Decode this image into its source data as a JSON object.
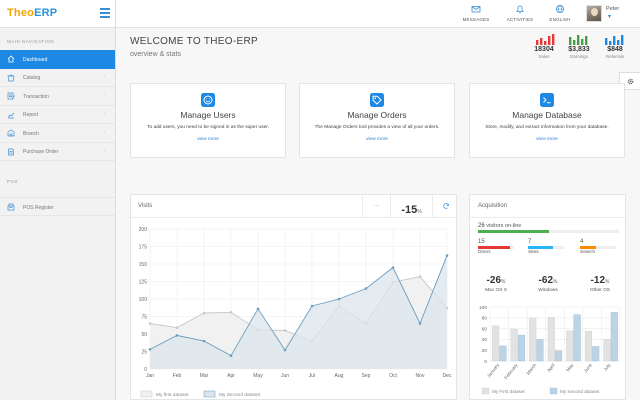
{
  "brand": {
    "part1": "Theo",
    "part2": "ERP"
  },
  "sidebar": {
    "main_heading": "MAIN NAVIGATION",
    "items": [
      {
        "label": "Dashboard",
        "icon": "home-icon",
        "active": true
      },
      {
        "label": "Catalog",
        "icon": "catalog-icon"
      },
      {
        "label": "Transaction",
        "icon": "transaction-icon"
      },
      {
        "label": "Report",
        "icon": "report-icon"
      },
      {
        "label": "Branch",
        "icon": "branch-icon"
      },
      {
        "label": "Purchase Order",
        "icon": "purchase-order-icon"
      }
    ],
    "pos_heading": "POS",
    "pos_items": [
      {
        "label": "POS Register",
        "icon": "pos-register-icon"
      }
    ],
    "chevron": "‹"
  },
  "topbar": {
    "messages": "MESSAGES",
    "activities": "ACTIVITIES",
    "language": "ENGLISH",
    "user_name": "Peter"
  },
  "header": {
    "title": "WELCOME TO THEO-ERP",
    "subtitle": "overview & stats"
  },
  "stats": [
    {
      "value": "18304",
      "label": "Sales",
      "color": "#e53935"
    },
    {
      "value": "$3,833",
      "label": "Earnings",
      "color": "#43a047"
    },
    {
      "value": "$848",
      "label": "Referrals",
      "color": "#1e88e5"
    }
  ],
  "cards": [
    {
      "title": "Manage Users",
      "desc": "To add users, you need to be signed in as the super user.",
      "link": "view more"
    },
    {
      "title": "Manage Orders",
      "desc": "The Manage Orders tool provides a view of all your orders.",
      "link": "view more"
    },
    {
      "title": "Manage Database",
      "desc": "Store, modify, and extract information from your database.",
      "link": "view more"
    }
  ],
  "visits": {
    "title": "Visits",
    "more": "···",
    "value": "-15",
    "unit": "%",
    "legend": [
      "My first dataset",
      "My Second dataset"
    ]
  },
  "acquisition": {
    "title": "Acquisition",
    "online_count": "26",
    "online_label": "visitors on-line",
    "online_fraction": 0.5,
    "sources": [
      {
        "count": "15",
        "label": "Direct",
        "color": "#e53935",
        "fraction": 0.9
      },
      {
        "count": "7",
        "label": "Sites",
        "color": "#29b6f6",
        "fraction": 0.7
      },
      {
        "count": "4",
        "label": "Search",
        "color": "#fb8c00",
        "fraction": 0.45
      }
    ],
    "os": [
      {
        "value": "-26",
        "unit": "%",
        "label": "Mac OS X"
      },
      {
        "value": "-62",
        "unit": "%",
        "label": "Windows"
      },
      {
        "value": "-12",
        "unit": "%",
        "label": "Other OS"
      }
    ],
    "legend": [
      "My First dataset",
      "My Second dataset"
    ]
  },
  "chart_data": [
    {
      "type": "line",
      "x": [
        "Jan",
        "Feb",
        "Mar",
        "Apr",
        "May",
        "Jun",
        "Jul",
        "Aug",
        "Sep",
        "Oct",
        "Nov",
        "Dec"
      ],
      "yticks": [
        0,
        25,
        50,
        75,
        100,
        125,
        150,
        175,
        200
      ],
      "ylim": [
        0,
        200
      ],
      "grid": true,
      "legend_position": "bottom",
      "series": [
        {
          "name": "My first dataset",
          "values": [
            65,
            59,
            80,
            81,
            56,
            55,
            40,
            90,
            65,
            124,
            132,
            87
          ],
          "color": "#c8c8c8",
          "fill": "#f1f1f1"
        },
        {
          "name": "My Second dataset",
          "values": [
            28,
            48,
            40,
            19,
            86,
            27,
            90,
            100,
            115,
            145,
            65,
            162
          ],
          "color": "#6a9fc0",
          "fill": "#dbe4ec"
        }
      ]
    },
    {
      "type": "bar",
      "categories": [
        "January",
        "February",
        "March",
        "April",
        "May",
        "June",
        "July"
      ],
      "yticks": [
        0,
        20,
        40,
        60,
        80,
        100
      ],
      "ylim": [
        0,
        100
      ],
      "grid": true,
      "legend_position": "bottom",
      "series": [
        {
          "name": "My First dataset",
          "values": [
            65,
            59,
            80,
            81,
            56,
            55,
            40
          ],
          "color": "#e2e2e2"
        },
        {
          "name": "My Second dataset",
          "values": [
            28,
            48,
            40,
            19,
            86,
            27,
            90
          ],
          "color": "#bcd3e4"
        }
      ]
    }
  ]
}
